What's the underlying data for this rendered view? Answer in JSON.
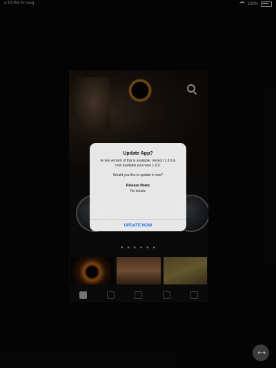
{
  "status_bar": {
    "time": "4:19 PM",
    "date": "Fri Aug",
    "battery": "100%"
  },
  "app": {
    "page_dots": "● ● ● ● ● ●",
    "tabs": [
      {
        "name": "home"
      },
      {
        "name": "browse"
      },
      {
        "name": "music"
      },
      {
        "name": "search"
      },
      {
        "name": "more"
      }
    ]
  },
  "alert": {
    "title": "Update App?",
    "message": "A new version of this is available. Version 1.3.0 is now available you have 1.0.0.",
    "prompt": "Would you like to update it now?",
    "release_notes_title": "Release Notes",
    "release_notes_body": "No details",
    "button": "UPDATE NOW"
  },
  "floating_button": {
    "icon": "expand-icon"
  }
}
